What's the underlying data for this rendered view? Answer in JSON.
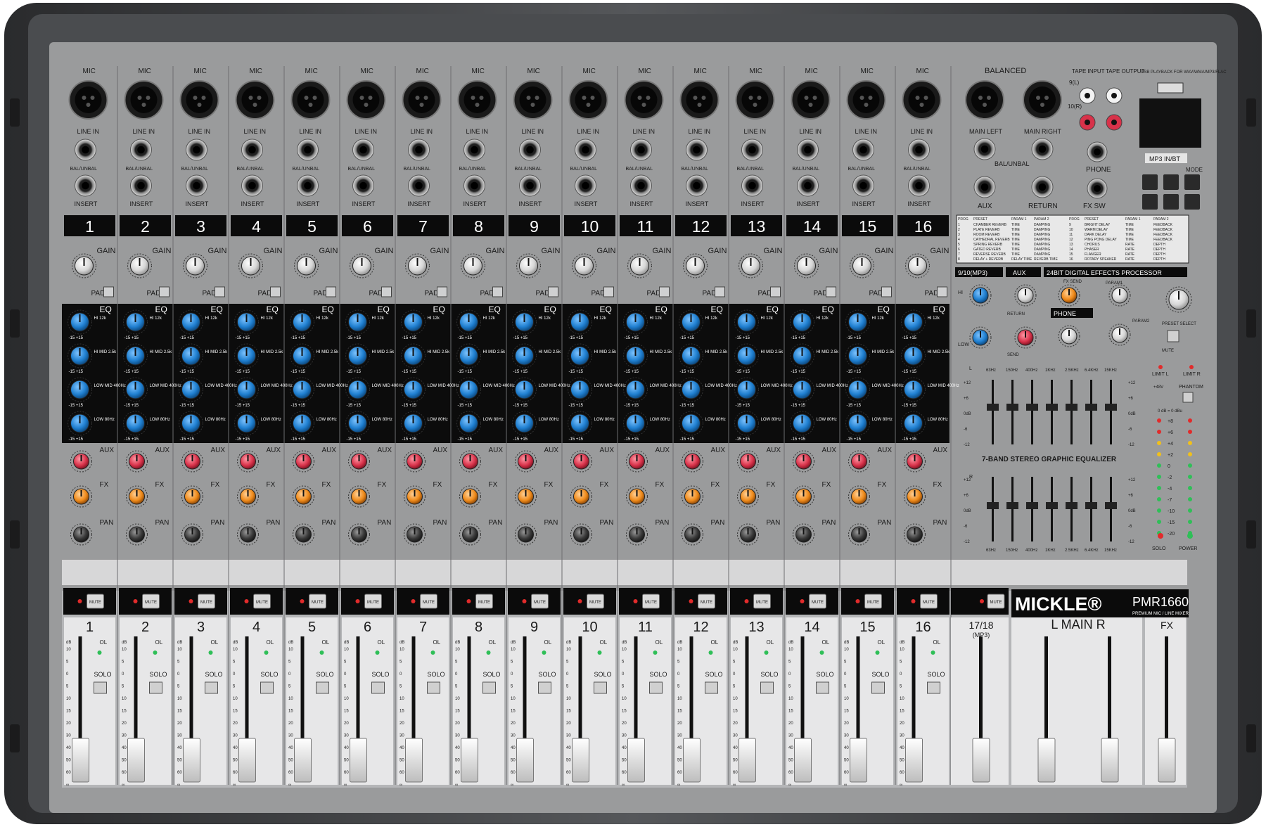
{
  "brand": {
    "name": "MICKLE®",
    "model": "PMR1660",
    "tagline": "PREMIUM MIC / LINE MIXER"
  },
  "channels": [
    "1",
    "2",
    "3",
    "4",
    "5",
    "6",
    "7",
    "8",
    "9",
    "10",
    "11",
    "12",
    "13",
    "14",
    "15",
    "16"
  ],
  "jack_labels": {
    "mic": "MIC",
    "line_in": "LINE IN",
    "bal_unbal": "BAL/UNBAL",
    "insert": "INSERT"
  },
  "knob_labels": {
    "gain": "GAIN",
    "pad": "PAD",
    "eq": "EQ",
    "eq_bands": [
      "HI 12k",
      "HI MID 2.5k",
      "LOW MID 400Hz",
      "LOW 80Hz"
    ],
    "aux": "AUX",
    "fx": "FX",
    "pan": "PAN",
    "range": "-15 +15"
  },
  "strip": {
    "mute": "MUTE",
    "ol": "OL",
    "solo": "SOLO",
    "db": "dB",
    "fader_scale": [
      "10",
      "5",
      "0",
      "5",
      "10",
      "15",
      "20",
      "30",
      "40",
      "50",
      "60",
      "∞"
    ]
  },
  "extra_strips": [
    {
      "number": "17/18",
      "sub": "(MP3)"
    },
    {
      "number": "L  MAIN  R",
      "sub": ""
    },
    {
      "number": "FX",
      "sub": ""
    }
  ],
  "master_inputs": {
    "balanced": "BALANCED",
    "main_left": "MAIN LEFT",
    "main_right": "MAIN RIGHT",
    "bal_unbal": "BAL/UNBAL",
    "aux": "AUX",
    "return": "RETURN",
    "tape_input": "TAPE INPUT",
    "tape_output": "TAPE OUTPUT",
    "ch9": "9(L)",
    "ch10": "10(R)",
    "phone": "PHONE",
    "fx_sw": "FX SW",
    "usb": "USB PLAYBACK FOR WAV/WMA/MP3/FLAC",
    "mp3_bt": "MP3 IN/BT",
    "mode": "MODE"
  },
  "effects_table": {
    "headers": [
      "PROG",
      "PRESET",
      "PARAM 1",
      "PARAM 2",
      "PROG",
      "PRESET",
      "PARAM 1",
      "PARAM 2"
    ],
    "rows": [
      [
        "1",
        "CHAMBER REVERB",
        "TIME",
        "DAMPING",
        "9",
        "BRIGHT DELAY",
        "TIME",
        "FEEDBACK"
      ],
      [
        "2",
        "PLATE REVERB",
        "TIME",
        "DAMPING",
        "10",
        "WARM DELAY",
        "TIME",
        "FEEDBACK"
      ],
      [
        "3",
        "ROOM REVERB",
        "TIME",
        "DAMPING",
        "11",
        "DARK DELAY",
        "TIME",
        "FEEDBACK"
      ],
      [
        "4",
        "CATHEDRAL REVERB",
        "TIME",
        "DAMPING",
        "12",
        "PING PONG DELAY",
        "TIME",
        "FEEDBACK"
      ],
      [
        "5",
        "SPRING REVERB",
        "TIME",
        "DAMPING",
        "13",
        "CHORUS",
        "RATE",
        "DEPTH"
      ],
      [
        "6",
        "GATED REVERB",
        "TIME",
        "DAMPING",
        "14",
        "PHASER",
        "RATE",
        "DEPTH"
      ],
      [
        "7",
        "REVERSE REVERB",
        "TIME",
        "DAMPING",
        "15",
        "FLANGER",
        "RATE",
        "DEPTH"
      ],
      [
        "8",
        "DELAY + REVERB",
        "DELAY TIME",
        "REVERB TIME",
        "16",
        "ROTARY SPEAKER",
        "RATE",
        "DEPTH"
      ]
    ]
  },
  "master_section": {
    "mp3_label": "9/10(MP3)",
    "aux_label": "AUX",
    "dsp_label": "24BIT DIGITAL EFFECTS PROCESSOR",
    "phone_label": "PHONE",
    "hi": "HI",
    "low": "LOW",
    "return": "RETURN",
    "send": "SEND",
    "fx_send": "FX SEND",
    "param1": "PARAM1",
    "param2": "PARAM2",
    "preset_select": "PRESET SELECT",
    "mute": "MUTE"
  },
  "graphic_eq": {
    "title": "7-BAND STEREO GRAPHIC EQUALIZER",
    "bands": [
      "63Hz",
      "150Hz",
      "400Hz",
      "1KHz",
      "2.5KHz",
      "6.4KHz",
      "15KHz"
    ],
    "scale": [
      "+12",
      "+6",
      "0dB",
      "-6",
      "-12"
    ],
    "left": "L",
    "right": "R"
  },
  "meter": {
    "limit_l": "LIMIT L",
    "limit_r": "LIMIT R",
    "phantom": "PHANTOM",
    "v48": "+48V",
    "header": "0 dB = 0 dBu",
    "levels": [
      "+8",
      "+6",
      "+4",
      "+2",
      "0",
      "-2",
      "-4",
      "-7",
      "-10",
      "-15",
      "-20"
    ],
    "solo": "SOLO",
    "power": "POWER"
  },
  "colors": {
    "panel": "#9a9b9c",
    "chassis": "#3b3c3e",
    "knob_blue": "#1f7fd0",
    "knob_red": "#d8324a",
    "knob_orange": "#ef8a1a",
    "led_green": "#2fbf57",
    "led_red": "#e12b2b"
  }
}
